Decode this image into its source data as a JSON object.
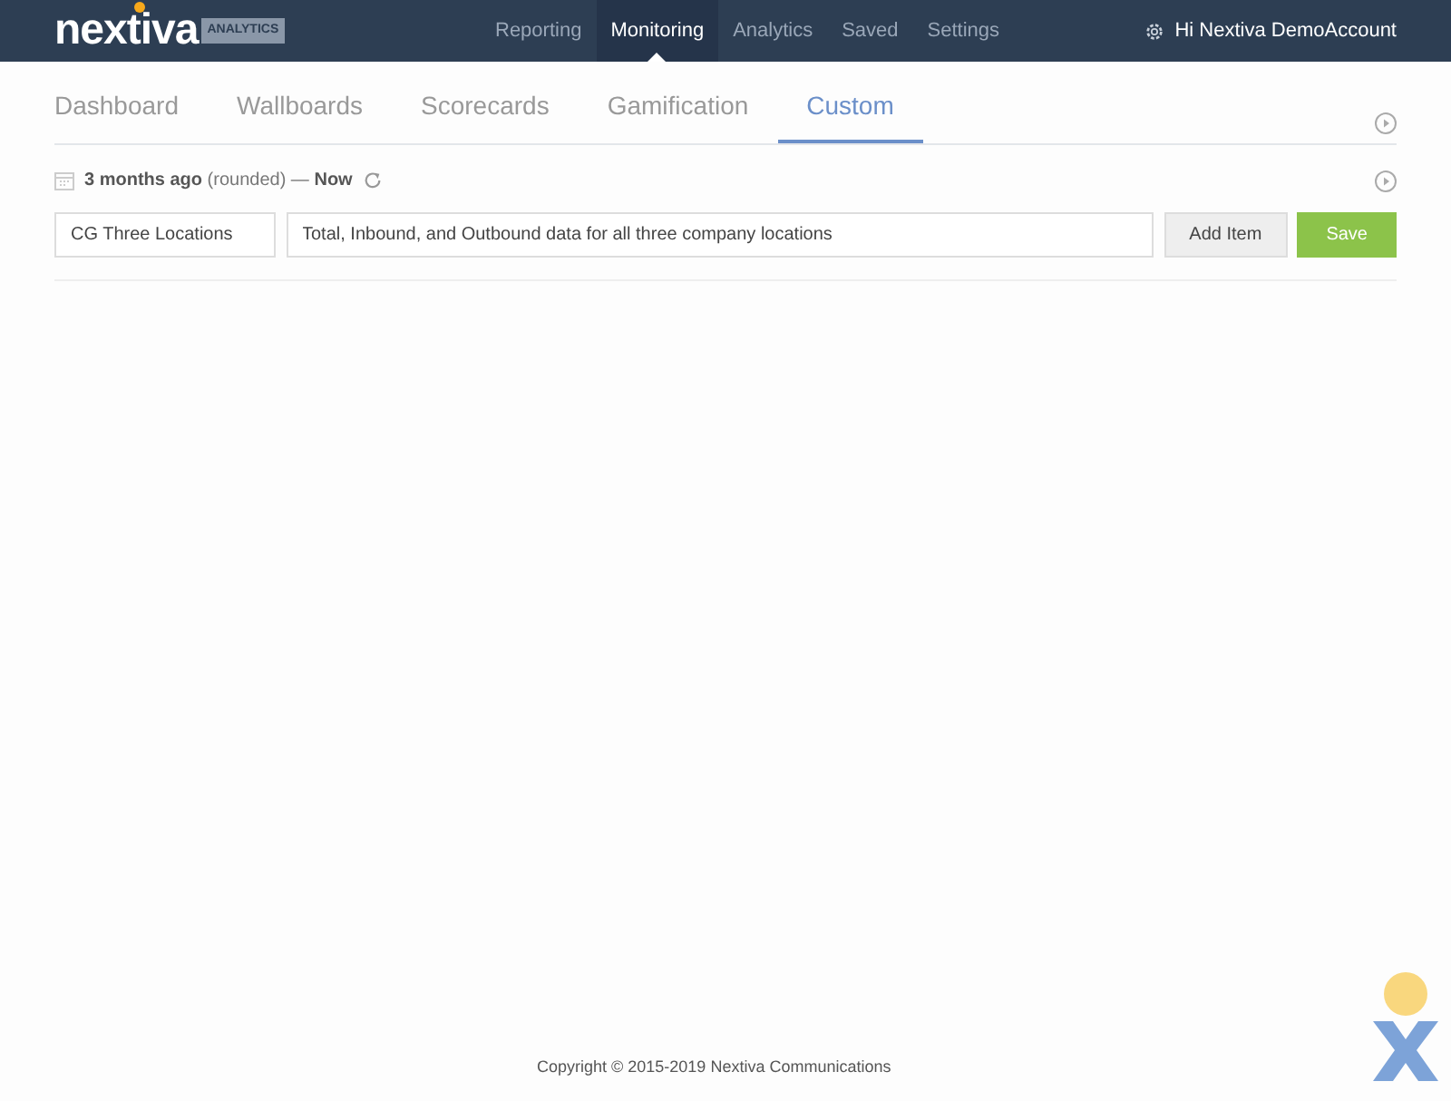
{
  "brand": {
    "name": "nextiva",
    "tag": "ANALYTICS"
  },
  "nav": [
    {
      "label": "Reporting",
      "selected": false
    },
    {
      "label": "Monitoring",
      "selected": true
    },
    {
      "label": "Analytics",
      "selected": false
    },
    {
      "label": "Saved",
      "selected": false
    },
    {
      "label": "Settings",
      "selected": false
    }
  ],
  "user": "Hi Nextiva DemoAccount",
  "tabs": [
    {
      "label": "Dashboard",
      "selected": false
    },
    {
      "label": "Wallboards",
      "selected": false
    },
    {
      "label": "Scorecards",
      "selected": false
    },
    {
      "label": "Gamification",
      "selected": false
    },
    {
      "label": "Custom",
      "selected": true
    }
  ],
  "range": "**3 months ago** (rounded) — **Now**",
  "form": {
    "name": "CG Three Locations",
    "description": "Total, Inbound, and Outbound data for all three company locations",
    "buttons": [
      {
        "label": "Add Item",
        "kind": "secondary"
      },
      {
        "label": "Save",
        "kind": "primary"
      }
    ]
  },
  "footer": "Copyright © 2015-2019 Nextiva Communications"
}
